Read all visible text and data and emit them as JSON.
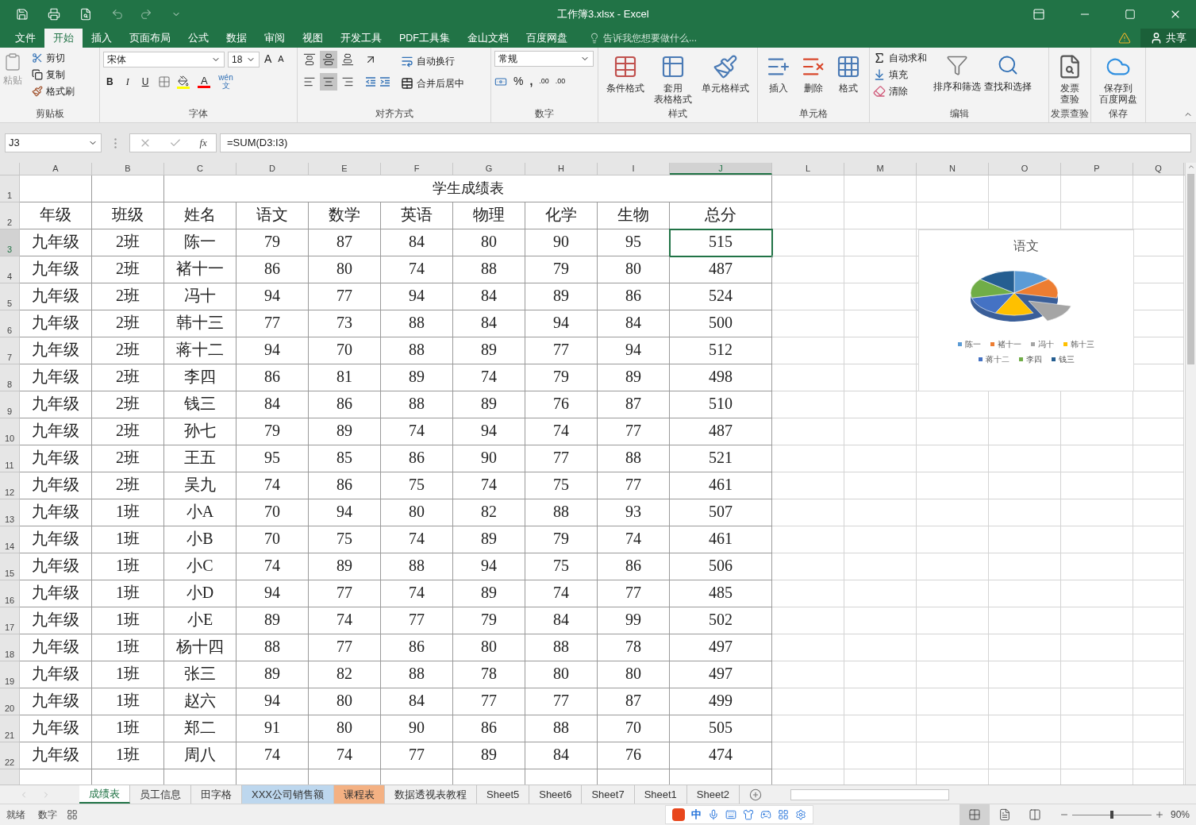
{
  "window": {
    "title": "工作簿3.xlsx - Excel"
  },
  "menu_tabs": [
    {
      "label": "文件",
      "selected": false
    },
    {
      "label": "开始",
      "selected": true
    },
    {
      "label": "插入",
      "selected": false
    },
    {
      "label": "页面布局",
      "selected": false
    },
    {
      "label": "公式",
      "selected": false
    },
    {
      "label": "数据",
      "selected": false
    },
    {
      "label": "审阅",
      "selected": false
    },
    {
      "label": "视图",
      "selected": false
    },
    {
      "label": "开发工具",
      "selected": false
    },
    {
      "label": "PDF工具集",
      "selected": false
    },
    {
      "label": "金山文档",
      "selected": false
    },
    {
      "label": "百度网盘",
      "selected": false
    }
  ],
  "tell_me": {
    "placeholder": "告诉我您想要做什么..."
  },
  "share": "共享",
  "ribbon": {
    "clipboard": {
      "paste": "粘贴",
      "cut": "剪切",
      "copy": "复制",
      "painter": "格式刷",
      "label": "剪贴板"
    },
    "font": {
      "name": "宋体",
      "size": "18",
      "grow": "A",
      "shrink": "A",
      "bold": "B",
      "italic": "I",
      "underline": "U",
      "color_letter": "A",
      "phonetic_top": "wén",
      "phonetic_bottom": "文",
      "label": "字体"
    },
    "alignment": {
      "v_align": [
        {
          "selected": false
        },
        {
          "selected": true
        },
        {
          "selected": false
        }
      ],
      "h_align": [
        {
          "selected": false
        },
        {
          "selected": true
        },
        {
          "selected": false
        }
      ],
      "wrap": "自动换行",
      "merge": "合并后居中",
      "label": "对齐方式"
    },
    "number": {
      "format": "常规",
      "percent": "%",
      "comma": ",",
      "decimal_more": ".00",
      "decimal_less": ".00",
      "label": "数字"
    },
    "large_groups": [
      {
        "label": "样式",
        "buttons": [
          {
            "kind": "conditional",
            "lines": [
              "条件格式"
            ]
          },
          {
            "kind": "table_format",
            "lines": [
              "套用",
              "表格格式"
            ]
          },
          {
            "kind": "cell_style",
            "lines": [
              "单元格样式"
            ]
          }
        ]
      },
      {
        "label": "单元格",
        "buttons": [
          {
            "kind": "insert",
            "lines": [
              "插入"
            ]
          },
          {
            "kind": "delete",
            "lines": [
              "删除"
            ]
          },
          {
            "kind": "format",
            "lines": [
              "格式"
            ]
          }
        ]
      }
    ],
    "editing": {
      "autosum": "自动求和",
      "fill": "填充",
      "clear": "清除",
      "sort": "排序和筛选",
      "find": "查找和选择",
      "label": "编辑"
    },
    "tail_groups": [
      {
        "label": "发票查验",
        "buttons": [
          {
            "kind": "invoice",
            "lines": [
              "发票",
              "查验"
            ]
          }
        ]
      },
      {
        "label": "保存",
        "buttons": [
          {
            "kind": "cloud",
            "lines": [
              "保存到",
              "百度网盘"
            ]
          }
        ]
      }
    ]
  },
  "formula_bar": {
    "name_box": "J3",
    "fx": "fx",
    "formula": "=SUM(D3:I3)"
  },
  "sheet": {
    "columns": [
      {
        "label": "A",
        "selected": false
      },
      {
        "label": "B",
        "selected": false
      },
      {
        "label": "C",
        "selected": false
      },
      {
        "label": "D",
        "selected": false
      },
      {
        "label": "E",
        "selected": false
      },
      {
        "label": "F",
        "selected": false
      },
      {
        "label": "G",
        "selected": false
      },
      {
        "label": "H",
        "selected": false
      },
      {
        "label": "I",
        "selected": false
      },
      {
        "label": "J",
        "selected": true
      },
      {
        "label": "L",
        "selected": false
      },
      {
        "label": "M",
        "selected": false
      },
      {
        "label": "N",
        "selected": false
      },
      {
        "label": "O",
        "selected": false
      },
      {
        "label": "P",
        "selected": false
      },
      {
        "label": "Q",
        "selected": false
      }
    ],
    "row_headers": [
      {
        "label": "1",
        "selected": false
      },
      {
        "label": "2",
        "selected": false
      },
      {
        "label": "3",
        "selected": true
      },
      {
        "label": "4",
        "selected": false
      },
      {
        "label": "5",
        "selected": false
      },
      {
        "label": "6",
        "selected": false
      },
      {
        "label": "7",
        "selected": false
      },
      {
        "label": "8",
        "selected": false
      },
      {
        "label": "9",
        "selected": false
      },
      {
        "label": "10",
        "selected": false
      },
      {
        "label": "11",
        "selected": false
      },
      {
        "label": "12",
        "selected": false
      },
      {
        "label": "13",
        "selected": false
      },
      {
        "label": "14",
        "selected": false
      },
      {
        "label": "15",
        "selected": false
      },
      {
        "label": "16",
        "selected": false
      },
      {
        "label": "17",
        "selected": false
      },
      {
        "label": "18",
        "selected": false
      },
      {
        "label": "19",
        "selected": false
      },
      {
        "label": "20",
        "selected": false
      },
      {
        "label": "21",
        "selected": false
      },
      {
        "label": "22",
        "selected": false
      }
    ],
    "title": "学生成绩表",
    "header": [
      "年级",
      "班级",
      "姓名",
      "语文",
      "数学",
      "英语",
      "物理",
      "化学",
      "生物",
      "总分"
    ],
    "rows": [
      [
        "九年级",
        "2班",
        "陈一",
        "79",
        "87",
        "84",
        "80",
        "90",
        "95",
        "515"
      ],
      [
        "九年级",
        "2班",
        "褚十一",
        "86",
        "80",
        "74",
        "88",
        "79",
        "80",
        "487"
      ],
      [
        "九年级",
        "2班",
        "冯十",
        "94",
        "77",
        "94",
        "84",
        "89",
        "86",
        "524"
      ],
      [
        "九年级",
        "2班",
        "韩十三",
        "77",
        "73",
        "88",
        "84",
        "94",
        "84",
        "500"
      ],
      [
        "九年级",
        "2班",
        "蒋十二",
        "94",
        "70",
        "88",
        "89",
        "77",
        "94",
        "512"
      ],
      [
        "九年级",
        "2班",
        "李四",
        "86",
        "81",
        "89",
        "74",
        "79",
        "89",
        "498"
      ],
      [
        "九年级",
        "2班",
        "钱三",
        "84",
        "86",
        "88",
        "89",
        "76",
        "87",
        "510"
      ],
      [
        "九年级",
        "2班",
        "孙七",
        "79",
        "89",
        "74",
        "94",
        "74",
        "77",
        "487"
      ],
      [
        "九年级",
        "2班",
        "王五",
        "95",
        "85",
        "86",
        "90",
        "77",
        "88",
        "521"
      ],
      [
        "九年级",
        "2班",
        "吴九",
        "74",
        "86",
        "75",
        "74",
        "75",
        "77",
        "461"
      ],
      [
        "九年级",
        "1班",
        "小A",
        "70",
        "94",
        "80",
        "82",
        "88",
        "93",
        "507"
      ],
      [
        "九年级",
        "1班",
        "小B",
        "70",
        "75",
        "74",
        "89",
        "79",
        "74",
        "461"
      ],
      [
        "九年级",
        "1班",
        "小C",
        "74",
        "89",
        "88",
        "94",
        "75",
        "86",
        "506"
      ],
      [
        "九年级",
        "1班",
        "小D",
        "94",
        "77",
        "74",
        "89",
        "74",
        "77",
        "485"
      ],
      [
        "九年级",
        "1班",
        "小E",
        "89",
        "74",
        "77",
        "79",
        "84",
        "99",
        "502"
      ],
      [
        "九年级",
        "1班",
        "杨十四",
        "88",
        "77",
        "86",
        "80",
        "88",
        "78",
        "497"
      ],
      [
        "九年级",
        "1班",
        "张三",
        "89",
        "82",
        "88",
        "78",
        "80",
        "80",
        "497"
      ],
      [
        "九年级",
        "1班",
        "赵六",
        "94",
        "80",
        "84",
        "77",
        "77",
        "87",
        "499"
      ],
      [
        "九年级",
        "1班",
        "郑二",
        "91",
        "80",
        "90",
        "86",
        "88",
        "70",
        "505"
      ],
      [
        "九年级",
        "1班",
        "周八",
        "74",
        "74",
        "77",
        "89",
        "84",
        "76",
        "474"
      ]
    ]
  },
  "chart": {
    "title": "语文",
    "legend": [
      {
        "label": "陈一",
        "color": "#5b9bd5"
      },
      {
        "label": "褚十一",
        "color": "#ed7d31"
      },
      {
        "label": "冯十",
        "color": "#a5a5a5"
      },
      {
        "label": "韩十三",
        "color": "#ffc000"
      },
      {
        "label": "蒋十二",
        "color": "#4472c4"
      },
      {
        "label": "李四",
        "color": "#70ad47"
      },
      {
        "label": "钱三",
        "color": "#255e91"
      }
    ]
  },
  "sheet_tabs": [
    {
      "label": "成绩表",
      "selected": true
    },
    {
      "label": "员工信息",
      "selected": false
    },
    {
      "label": "田字格",
      "selected": false
    },
    {
      "label": "XXX公司销售额",
      "selected": false,
      "color": "#bdd7ee"
    },
    {
      "label": "课程表",
      "selected": false,
      "color": "#f4b183"
    },
    {
      "label": "数据透视表教程",
      "selected": false
    },
    {
      "label": "Sheet5",
      "selected": false
    },
    {
      "label": "Sheet6",
      "selected": false
    },
    {
      "label": "Sheet7",
      "selected": false
    },
    {
      "label": "Sheet1",
      "selected": false
    },
    {
      "label": "Sheet2",
      "selected": false
    }
  ],
  "status_bar": {
    "ready": "就绪",
    "mode": "数字",
    "ime": "中",
    "views": [
      {
        "selected": true
      },
      {
        "selected": false
      },
      {
        "selected": false
      }
    ],
    "zoom": {
      "level": 0.48,
      "reading": "90%"
    }
  }
}
